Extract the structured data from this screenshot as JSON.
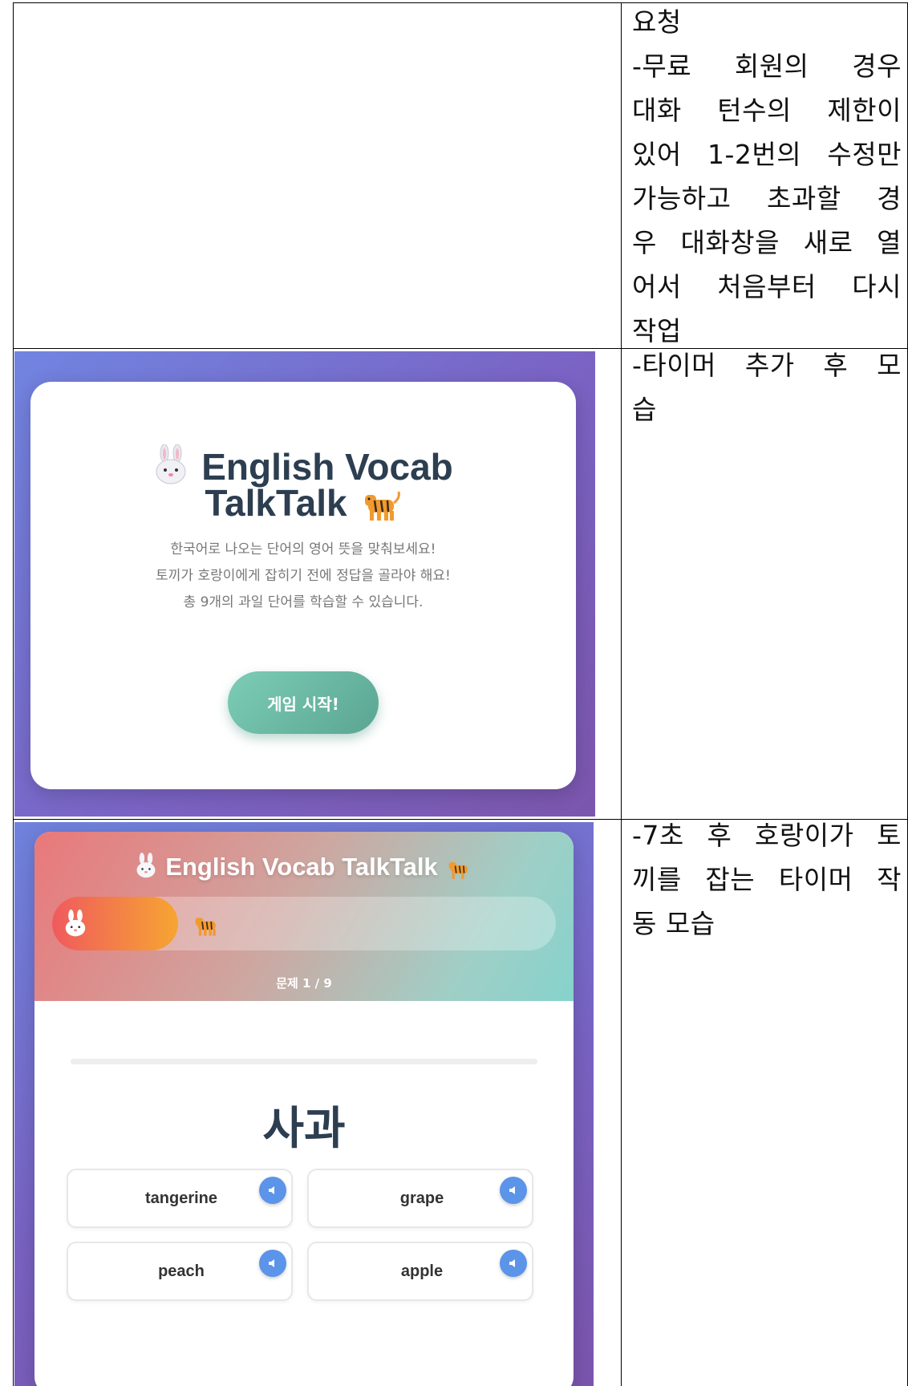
{
  "rows": [
    {
      "note_lines": [
        "요청",
        "-무료 회원의 경우",
        "대화 턴수의 제한이",
        "있어 1-2번의 수정만",
        "가능하고 초과할 경",
        "우 대화창을 새로 열",
        "어서 처음부터 다시",
        "작업"
      ]
    },
    {
      "note_lines": [
        "-타이머 추가 후 모",
        "습"
      ],
      "screenshot": {
        "title_line1": "English Vocab",
        "title_line2": "TalkTalk",
        "desc_lines": [
          "한국어로 나오는 단어의 영어 뜻을 맞춰보세요!",
          "토끼가 호랑이에게 잡히기 전에 정답을 골라야 해요!",
          "총 9개의 과일 단어를 학습할 수 있습니다."
        ],
        "start_button": "게임 시작!",
        "icons": [
          "rabbit-icon",
          "tiger-icon"
        ]
      }
    },
    {
      "note_lines": [
        "-7초 후 호랑이가 토",
        "끼를 잡는 타이머 작",
        "동 모습"
      ],
      "screenshot": {
        "header_title": "English Vocab TalkTalk",
        "timer_progress": 0.25,
        "progress_label": "문제 1 / 9",
        "korean_word": "사과",
        "options": [
          "tangerine",
          "grape",
          "peach",
          "apple"
        ],
        "colors": {
          "timer_start": "#f05a5e",
          "timer_end": "#f6a532",
          "start_button": "#6cbba6",
          "audio_button": "#5b94e8"
        }
      }
    }
  ]
}
